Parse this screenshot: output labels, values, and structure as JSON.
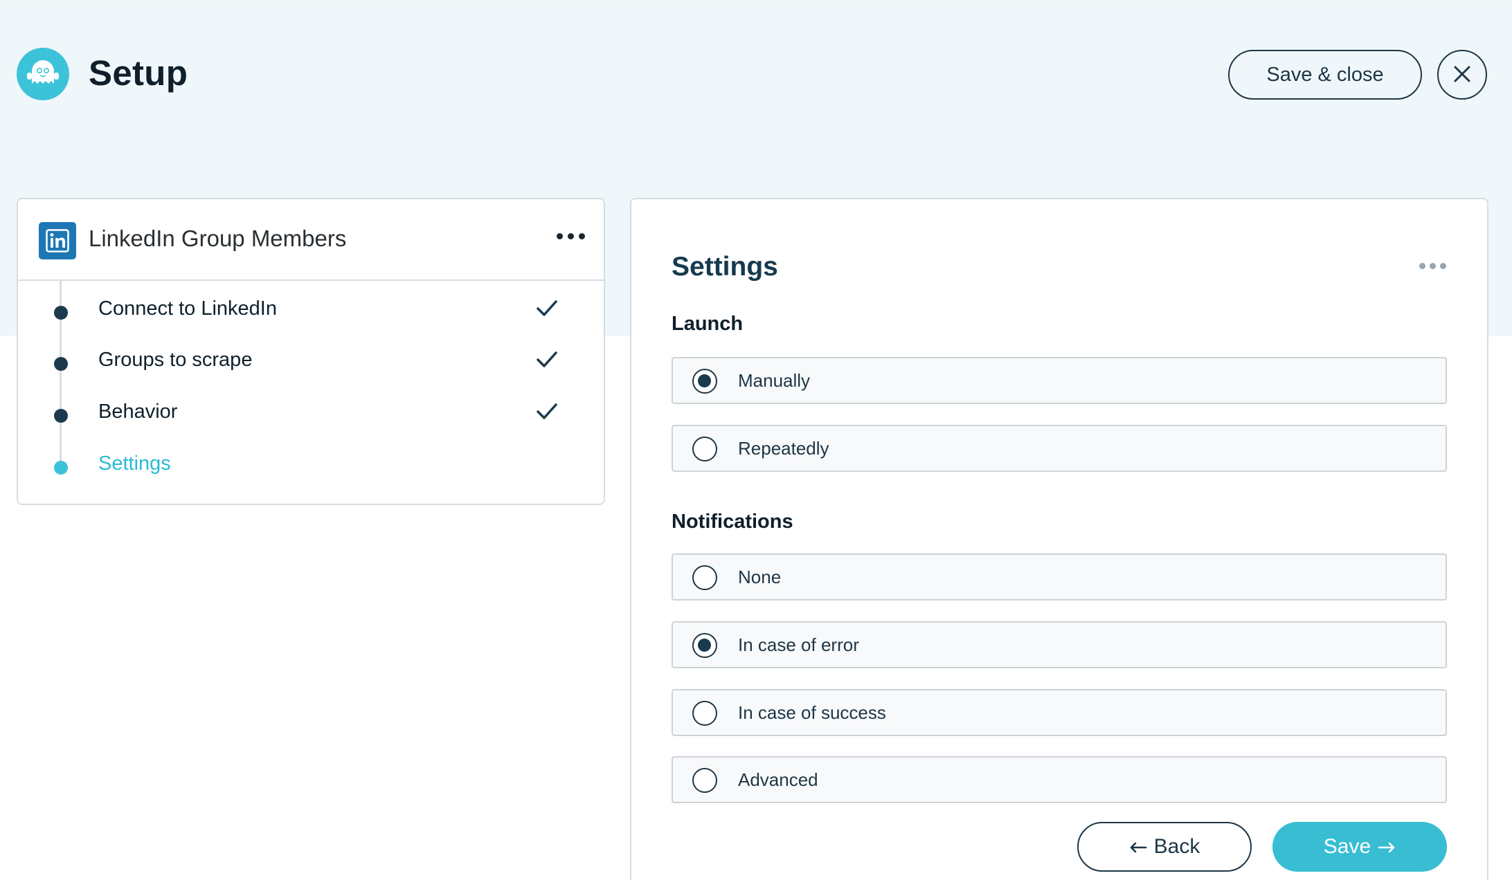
{
  "header": {
    "title": "Setup",
    "logo_icon": "ghost-icon",
    "save_close_label": "Save & close",
    "close_icon": "close-icon"
  },
  "steps_panel": {
    "title": "LinkedIn Group Members",
    "logo_icon": "linkedin-icon",
    "menu_icon": "more-horizontal-icon",
    "steps": [
      {
        "label": "Connect to LinkedIn",
        "status": "complete"
      },
      {
        "label": "Groups to scrape",
        "status": "complete"
      },
      {
        "label": "Behavior",
        "status": "complete"
      },
      {
        "label": "Settings",
        "status": "active"
      }
    ]
  },
  "settings": {
    "title": "Settings",
    "menu_icon": "more-horizontal-icon",
    "launch": {
      "label": "Launch",
      "options": [
        {
          "label": "Manually",
          "checked": true
        },
        {
          "label": "Repeatedly",
          "checked": false
        }
      ]
    },
    "notifications": {
      "label": "Notifications",
      "options": [
        {
          "label": "None",
          "checked": false
        },
        {
          "label": "In case of error",
          "checked": true
        },
        {
          "label": "In case of success",
          "checked": false
        },
        {
          "label": "Advanced",
          "checked": false
        }
      ]
    },
    "back_label": "Back",
    "save_label": "Save"
  },
  "colors": {
    "accent": "#38bdd3",
    "dark": "#1d3646",
    "background": "#f0f7fa",
    "linkedin": "#1e77b5"
  }
}
